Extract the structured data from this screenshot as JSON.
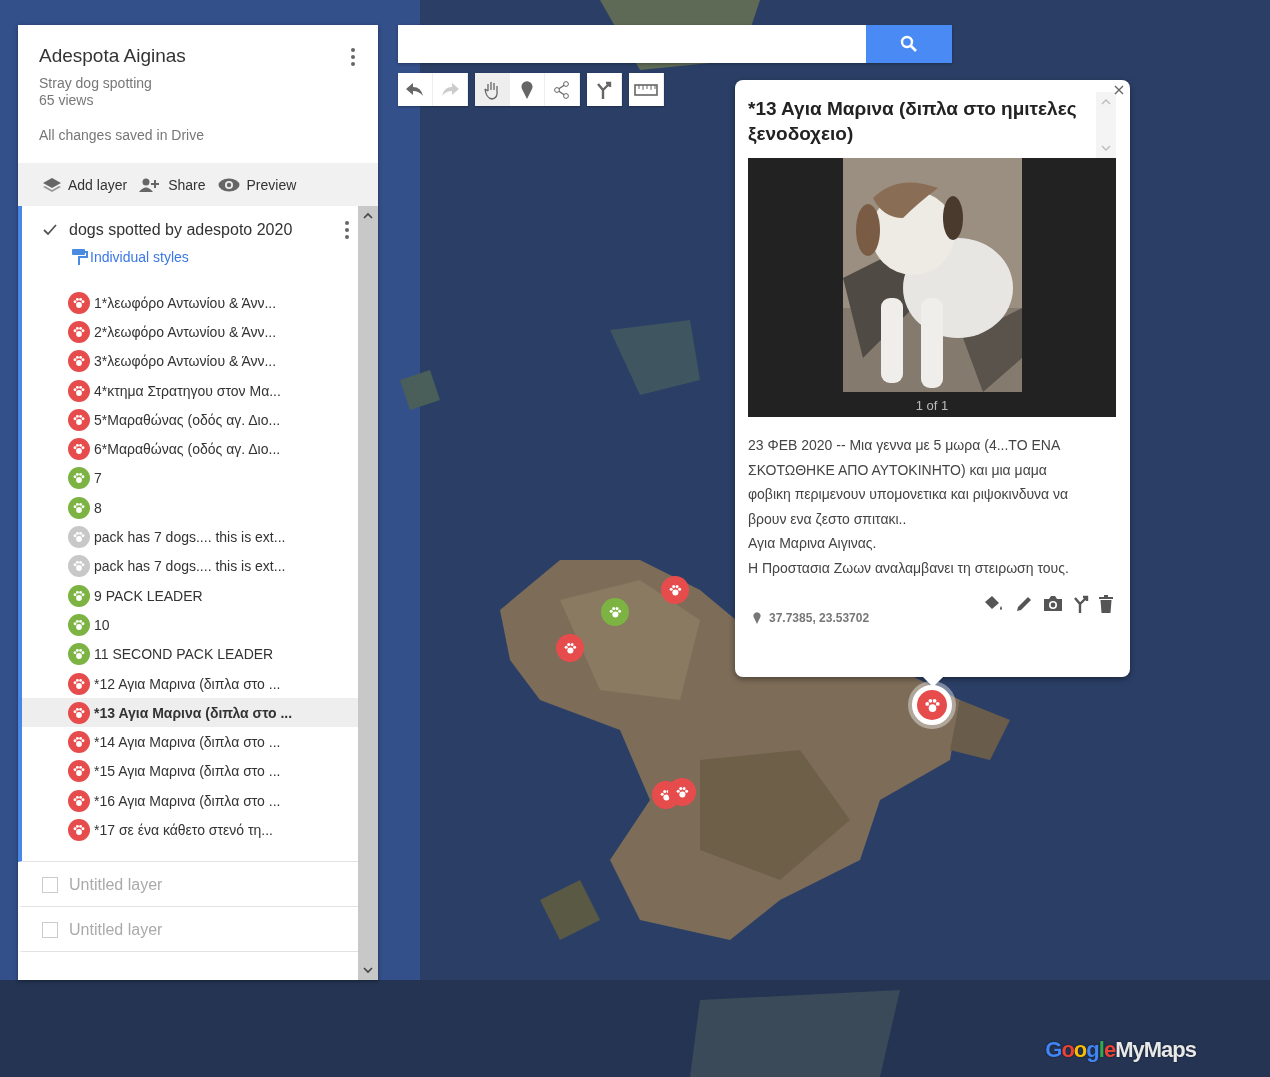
{
  "map": {
    "title": "Adespota Aiginas",
    "description": "Stray dog spotting",
    "views": "65 views",
    "save_status": "All changes saved in Drive"
  },
  "actions": [
    {
      "kind": "add-layer",
      "label": "Add layer"
    },
    {
      "kind": "share",
      "label": "Share"
    },
    {
      "kind": "preview",
      "label": "Preview"
    }
  ],
  "layers": [
    {
      "name": "dogs spotted by adespoto 2020",
      "checked": true,
      "selected": true,
      "style_label": "Individual styles",
      "items": [
        {
          "label": "1*λεωφόρο Αντωνίου & Άνν...",
          "color": "#e74c4c",
          "selected": false
        },
        {
          "label": "2*λεωφόρο Αντωνίου & Άνν...",
          "color": "#e74c4c",
          "selected": false
        },
        {
          "label": "3*λεωφόρο Αντωνίου & Άνν...",
          "color": "#e74c4c",
          "selected": false
        },
        {
          "label": "4*κτημα Στρατηγου στον Μα...",
          "color": "#e74c4c",
          "selected": false
        },
        {
          "label": "5*Μαραθώνας (οδός αγ. Διο...",
          "color": "#e74c4c",
          "selected": false
        },
        {
          "label": "6*Μαραθώνας (οδός αγ. Διο...",
          "color": "#e74c4c",
          "selected": false
        },
        {
          "label": "7",
          "color": "#7cb342",
          "selected": false
        },
        {
          "label": "8",
          "color": "#7cb342",
          "selected": false
        },
        {
          "label": "pack has 7 dogs.... this is ext...",
          "color": "#c8c8c8",
          "selected": false
        },
        {
          "label": "pack has 7 dogs.... this is ext...",
          "color": "#c8c8c8",
          "selected": false
        },
        {
          "label": "9 PACK LEADER",
          "color": "#7cb342",
          "selected": false
        },
        {
          "label": "10",
          "color": "#7cb342",
          "selected": false
        },
        {
          "label": "11 SECOND PACK LEADER",
          "color": "#7cb342",
          "selected": false
        },
        {
          "label": "*12 Αγια Μαρινα (διπλα στο ...",
          "color": "#e74c4c",
          "selected": false
        },
        {
          "label": "*13 Αγια Μαρινα (διπλα στο ...",
          "color": "#e74c4c",
          "selected": true
        },
        {
          "label": "*14 Αγια Μαρινα (διπλα στο ...",
          "color": "#e74c4c",
          "selected": false
        },
        {
          "label": "*15 Αγια Μαρινα (διπλα στο ...",
          "color": "#e74c4c",
          "selected": false
        },
        {
          "label": "*16 Αγια Μαρινα (διπλα στο ...",
          "color": "#e74c4c",
          "selected": false
        },
        {
          "label": "*17 σε ένα κάθετο στενό τη...",
          "color": "#e74c4c",
          "selected": false
        }
      ]
    },
    {
      "name": "Untitled layer",
      "checked": false,
      "selected": false
    },
    {
      "name": "Untitled layer",
      "checked": false,
      "selected": false
    }
  ],
  "tool_groups": [
    {
      "tools": [
        {
          "kind": "undo",
          "disabled": false,
          "selected": false
        },
        {
          "kind": "redo",
          "disabled": true,
          "selected": false
        }
      ]
    },
    {
      "tools": [
        {
          "kind": "hand",
          "disabled": false,
          "selected": true
        },
        {
          "kind": "marker",
          "disabled": false,
          "selected": false
        },
        {
          "kind": "line",
          "disabled": false,
          "selected": false
        }
      ]
    },
    {
      "tools": [
        {
          "kind": "directions",
          "disabled": false,
          "selected": false
        }
      ]
    },
    {
      "tools": [
        {
          "kind": "ruler",
          "disabled": false,
          "selected": false
        }
      ]
    }
  ],
  "popup": {
    "title": "*13 Αγια Μαρινα (διπλα στο ημιτελες ξενοδοχειο)",
    "photo_counter": "1 of 1",
    "description": [
      "23 ΦΕΒ 2020 -- Μια γεννα με 5 μωρα (4...ΤΟ ΕΝΑ ΣΚΟΤΩΘΗΚΕ ΑΠΟ ΑΥΤΟΚΙΝΗΤΟ) και μια μαμα φοβικη περιμενουν υπομονετικα και ριψοκινδυνα να βρουν ενα ζεστο σπιτακι..",
      "Αγια Μαρινα Αιγινας.",
      "Η Προστασια Ζωων αναλαμβανει τη στειρωση τους."
    ],
    "coordinates": "37.7385, 23.53702"
  },
  "markers": [
    {
      "color": "#e74c4c",
      "selected": false
    },
    {
      "color": "#7cb342",
      "selected": false
    },
    {
      "color": "#e74c4c",
      "selected": false
    },
    {
      "color": "#e74c4c",
      "selected": true
    },
    {
      "color": "#e74c4c",
      "selected": false
    },
    {
      "color": "#e74c4c",
      "selected": false
    }
  ],
  "logo": "GoogleMyMaps"
}
